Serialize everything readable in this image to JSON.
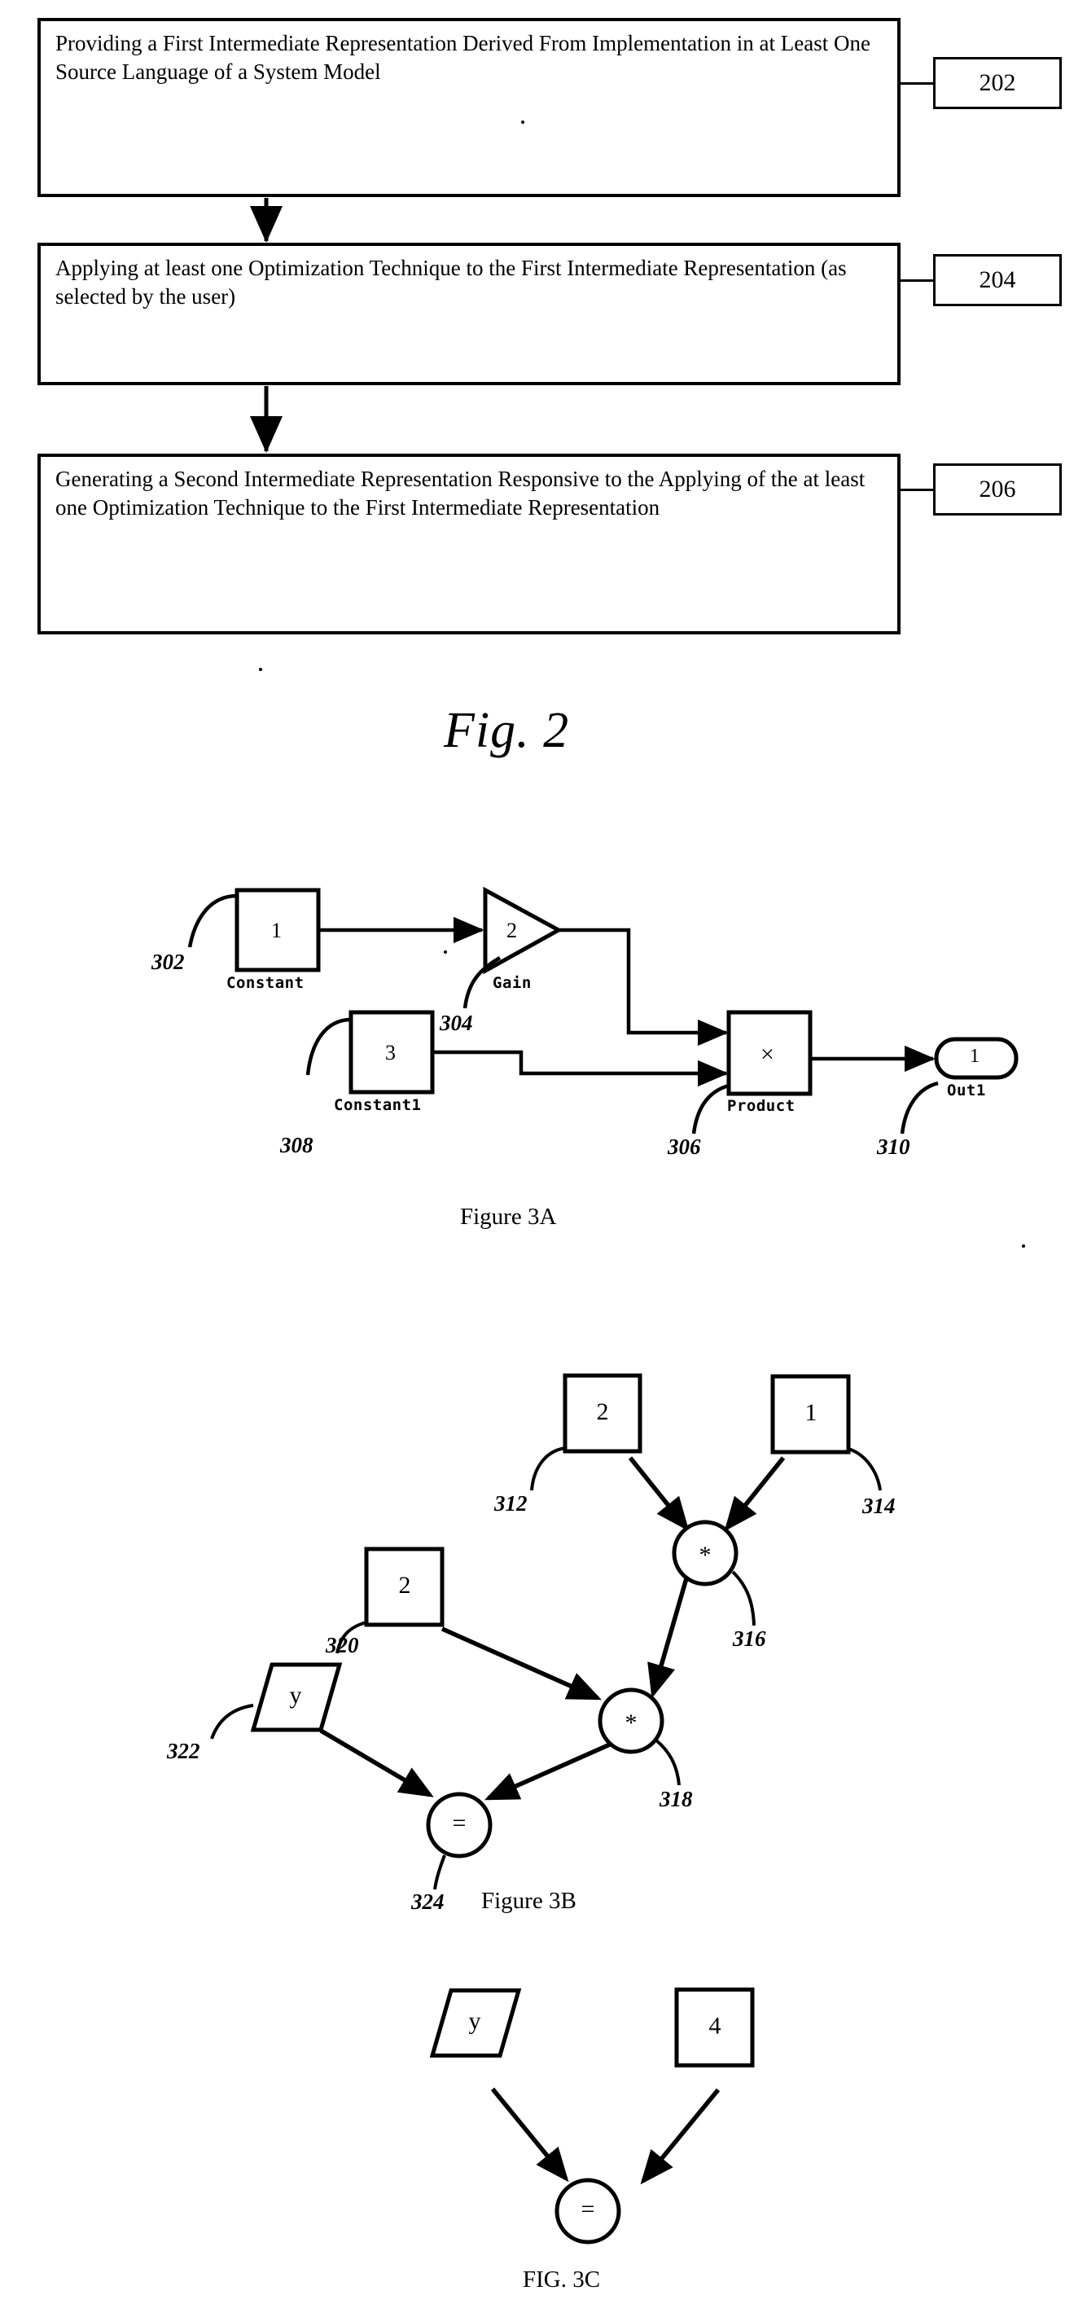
{
  "document": {
    "type": "patent-figure-sheet",
    "figures": [
      "Fig. 2",
      "Figure 3A",
      "Figure 3B",
      "FIG. 3C"
    ]
  },
  "fig2": {
    "caption": "Fig. 2",
    "steps": [
      {
        "ref": "202",
        "text": "Providing a First Intermediate Representation Derived From Implementation in at Least One Source Language of a System Model"
      },
      {
        "ref": "204",
        "text": "Applying at least one Optimization Technique to the First Intermediate Representation (as selected by the user)"
      },
      {
        "ref": "206",
        "text": "Generating a Second Intermediate Representation Responsive to the Applying of the at least one Optimization Technique to the First Intermediate Representation"
      }
    ]
  },
  "fig3a": {
    "caption": "Figure 3A",
    "blocks": [
      {
        "id": "constant",
        "value": "1",
        "label": "Constant",
        "ref": "302",
        "shape": "rect"
      },
      {
        "id": "gain",
        "value": "2",
        "label": "Gain",
        "ref": "304",
        "shape": "triangle"
      },
      {
        "id": "constant1",
        "value": "3",
        "label": "Constant1",
        "ref": "308",
        "shape": "rect"
      },
      {
        "id": "product",
        "value": "×",
        "label": "Product",
        "ref": "306",
        "shape": "rect"
      },
      {
        "id": "out1",
        "value": "1",
        "label": "Out1",
        "ref": "310",
        "shape": "rounded"
      }
    ]
  },
  "fig3b": {
    "caption": "Figure 3B",
    "nodes": [
      {
        "id": "const2a",
        "value": "2",
        "ref": "312",
        "shape": "rect"
      },
      {
        "id": "const1",
        "value": "1",
        "ref": "314",
        "shape": "rect"
      },
      {
        "id": "mul1",
        "value": "*",
        "ref": "316",
        "shape": "circle"
      },
      {
        "id": "const2b",
        "value": "2",
        "ref": "320",
        "shape": "rect"
      },
      {
        "id": "mul2",
        "value": "*",
        "ref": "318",
        "shape": "circle"
      },
      {
        "id": "vary",
        "value": "y",
        "ref": "322",
        "shape": "parallelogram"
      },
      {
        "id": "assign",
        "value": "=",
        "ref": "324",
        "shape": "circle"
      }
    ]
  },
  "fig3c": {
    "caption": "FIG. 3C",
    "nodes": [
      {
        "id": "vary",
        "value": "y",
        "shape": "parallelogram"
      },
      {
        "id": "const4",
        "value": "4",
        "shape": "rect"
      },
      {
        "id": "assign",
        "value": "=",
        "shape": "circle"
      }
    ]
  },
  "colors": {
    "ink": "#000000",
    "paper": "#ffffff"
  }
}
